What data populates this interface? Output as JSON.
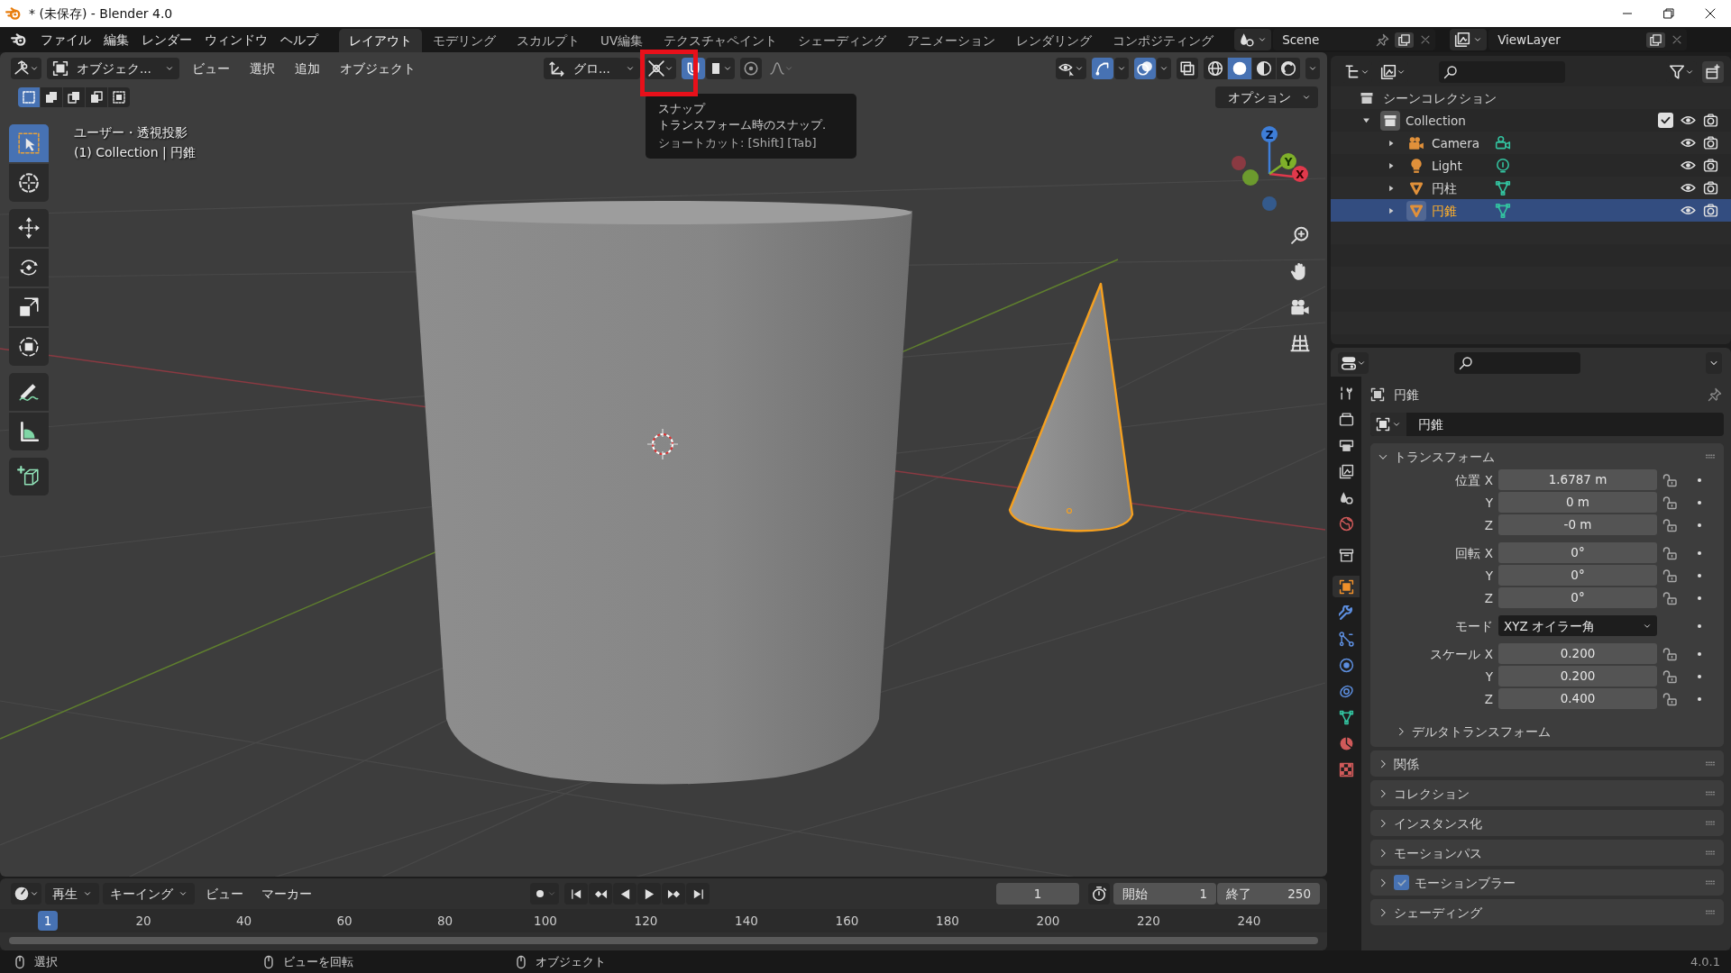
{
  "window": {
    "title": "* (未保存) - Blender 4.0"
  },
  "menus": [
    "ファイル",
    "編集",
    "レンダー",
    "ウィンドウ",
    "ヘルプ"
  ],
  "workspaces": [
    {
      "label": "レイアウト",
      "selected": true
    },
    {
      "label": "モデリング",
      "selected": false
    },
    {
      "label": "スカルプト",
      "selected": false
    },
    {
      "label": "UV編集",
      "selected": false
    },
    {
      "label": "テクスチャペイント",
      "selected": false
    },
    {
      "label": "シェーディング",
      "selected": false
    },
    {
      "label": "アニメーション",
      "selected": false
    },
    {
      "label": "レンダリング",
      "selected": false
    },
    {
      "label": "コンポジティング",
      "selected": false
    }
  ],
  "scene": {
    "name": "Scene"
  },
  "view_layer": {
    "name": "ViewLayer"
  },
  "viewport_header": {
    "mode": "オブジェク...",
    "menus": [
      "ビュー",
      "選択",
      "追加",
      "オブジェクト"
    ],
    "orientation": "グロ...",
    "snap_on": true,
    "gizmos_on": true,
    "overlays_on": true,
    "shading": [
      {
        "kind": "wireframe",
        "selected": false
      },
      {
        "kind": "solid",
        "selected": true
      },
      {
        "kind": "material",
        "selected": false
      },
      {
        "kind": "rendered",
        "selected": false
      }
    ],
    "select_modes": [
      {
        "selected": true
      },
      {
        "selected": false
      },
      {
        "selected": false
      },
      {
        "selected": false
      },
      {
        "selected": false
      }
    ],
    "options": "オプション"
  },
  "tooltip": {
    "title": "スナップ",
    "description": "トランスフォーム時のスナップ.",
    "shortcut": "ショートカット: [Shift] [Tab]"
  },
  "viewport": {
    "view_name": "ユーザー・透視投影",
    "context": "(1) Collection | 円錐",
    "axes": [
      "X",
      "Y",
      "Z"
    ]
  },
  "tool_groups": [
    [
      {
        "kind": "select",
        "selected": true
      },
      {
        "kind": "cursor",
        "selected": false
      }
    ],
    [
      {
        "kind": "move",
        "selected": false
      },
      {
        "kind": "rotate",
        "selected": false
      },
      {
        "kind": "scale",
        "selected": false
      },
      {
        "kind": "transform",
        "selected": false
      }
    ],
    [
      {
        "kind": "annotate",
        "selected": false
      },
      {
        "kind": "measure",
        "selected": false
      }
    ],
    [
      {
        "kind": "add_cube",
        "selected": false
      }
    ]
  ],
  "outliner": {
    "root": "シーンコレクション",
    "collections": [
      {
        "label": "Collection",
        "expanded": true,
        "included": true,
        "children": [
          {
            "label": "Camera",
            "kind": "camera",
            "selected": false
          },
          {
            "label": "Light",
            "kind": "light",
            "selected": false
          },
          {
            "label": "円柱",
            "kind": "mesh",
            "selected": false
          },
          {
            "label": "円錐",
            "kind": "mesh",
            "selected": true
          }
        ]
      }
    ]
  },
  "properties": {
    "tabs": [
      {
        "kind": "tool",
        "selected": false
      },
      {
        "kind": "render",
        "selected": false
      },
      {
        "kind": "output",
        "selected": false
      },
      {
        "kind": "view_layer",
        "selected": false
      },
      {
        "kind": "scene",
        "selected": false
      },
      {
        "kind": "world",
        "selected": false
      },
      {
        "kind": "collection",
        "selected": false
      },
      {
        "kind": "object",
        "selected": true
      },
      {
        "kind": "modifier",
        "selected": false
      },
      {
        "kind": "particles",
        "selected": false
      },
      {
        "kind": "physics",
        "selected": false
      },
      {
        "kind": "constraint",
        "selected": false
      },
      {
        "kind": "data",
        "selected": false
      },
      {
        "kind": "material",
        "selected": false
      },
      {
        "kind": "texture",
        "selected": false
      }
    ],
    "object": "円錐",
    "name": "円錐",
    "transform": {
      "title": "トランスフォーム",
      "expanded": true,
      "groups": [
        [
          {
            "kind": "number",
            "label": "位置 X",
            "value": "1.6787 m"
          },
          {
            "kind": "number",
            "label": "Y",
            "value": "0 m"
          },
          {
            "kind": "number",
            "label": "Z",
            "value": "-0 m"
          }
        ],
        [
          {
            "kind": "number",
            "label": "回転 X",
            "value": "0°"
          },
          {
            "kind": "number",
            "label": "Y",
            "value": "0°"
          },
          {
            "kind": "number",
            "label": "Z",
            "value": "0°"
          }
        ],
        [
          {
            "kind": "select",
            "label": "モード",
            "value": "XYZ オイラー角"
          }
        ],
        [
          {
            "kind": "number",
            "label": "スケール X",
            "value": "0.200"
          },
          {
            "kind": "number",
            "label": "Y",
            "value": "0.200"
          },
          {
            "kind": "number",
            "label": "Z",
            "value": "0.400"
          }
        ]
      ],
      "subpanel": {
        "title": "デルタトランスフォーム",
        "expanded": false
      }
    },
    "panels": [
      {
        "kind": "plain",
        "title": "関係",
        "expanded": false
      },
      {
        "kind": "plain",
        "title": "コレクション",
        "expanded": false
      },
      {
        "kind": "plain",
        "title": "インスタンス化",
        "expanded": false
      },
      {
        "kind": "plain",
        "title": "モーションパス",
        "expanded": false
      },
      {
        "kind": "checkbox",
        "title": "モーションブラー",
        "expanded": false,
        "checked": true
      },
      {
        "kind": "plain",
        "title": "シェーディング",
        "expanded": false
      }
    ]
  },
  "timeline": {
    "menus": [
      {
        "label": "再生",
        "dropdown": true
      },
      {
        "label": "キーイング",
        "dropdown": true
      },
      {
        "label": "ビュー",
        "dropdown": false
      },
      {
        "label": "マーカー",
        "dropdown": false
      }
    ],
    "current_frame": "1",
    "start_label": "開始",
    "start": "1",
    "end_label": "終了",
    "end": "250",
    "playhead": "1",
    "ticks": [
      "20",
      "40",
      "60",
      "80",
      "100",
      "120",
      "140",
      "160",
      "180",
      "200",
      "220",
      "240"
    ]
  },
  "status_bar": {
    "hints": [
      "選択",
      "ビューを回転",
      "オブジェクト"
    ],
    "version": "4.0.1"
  }
}
